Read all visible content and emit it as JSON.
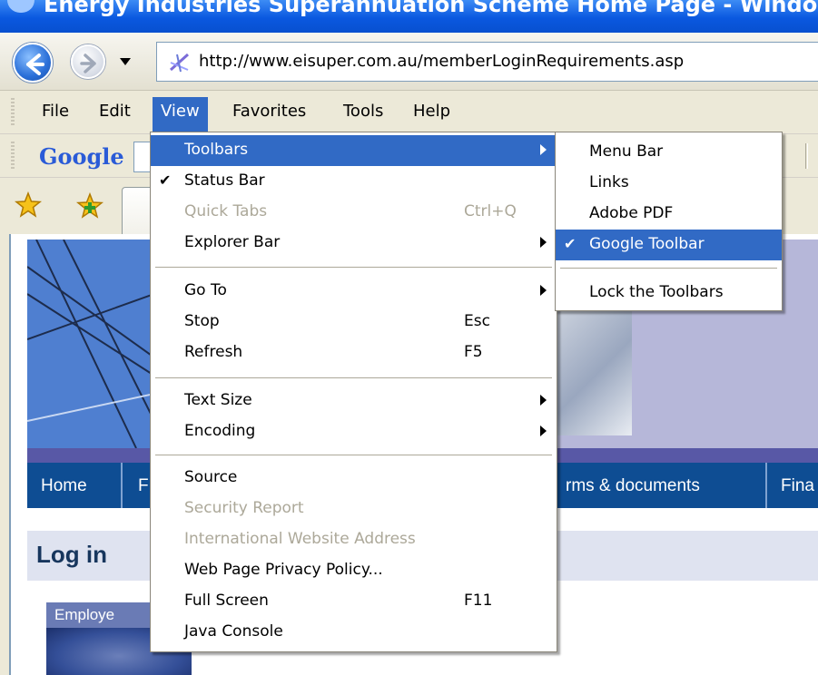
{
  "window": {
    "title": "Energy Industries Superannuation Scheme Home Page - Windows Inte"
  },
  "address_bar": {
    "url": "http://www.eisuper.com.au/memberLoginRequirements.asp"
  },
  "menu_bar": {
    "items": [
      {
        "label": "File"
      },
      {
        "label": "Edit"
      },
      {
        "label": "View"
      },
      {
        "label": "Favorites"
      },
      {
        "label": "Tools"
      },
      {
        "label": "Help"
      }
    ],
    "active": "View"
  },
  "google_toolbar": {
    "logo": "Google"
  },
  "view_menu": {
    "items": [
      {
        "label": "Toolbars",
        "submenu": true,
        "highlighted": true
      },
      {
        "label": "Status Bar",
        "checked": true
      },
      {
        "label": "Quick Tabs",
        "shortcut": "Ctrl+Q",
        "disabled": true
      },
      {
        "label": "Explorer Bar",
        "submenu": true
      },
      {
        "label": "Go To",
        "submenu": true
      },
      {
        "label": "Stop",
        "shortcut": "Esc"
      },
      {
        "label": "Refresh",
        "shortcut": "F5"
      },
      {
        "label": "Text Size",
        "submenu": true
      },
      {
        "label": "Encoding",
        "submenu": true
      },
      {
        "label": "Source"
      },
      {
        "label": "Security Report",
        "disabled": true
      },
      {
        "label": "International Website Address",
        "disabled": true
      },
      {
        "label": "Web Page Privacy Policy..."
      },
      {
        "label": "Full Screen",
        "shortcut": "F11"
      },
      {
        "label": "Java Console"
      }
    ]
  },
  "toolbars_submenu": {
    "items": [
      {
        "label": "Menu Bar"
      },
      {
        "label": "Links"
      },
      {
        "label": "Adobe PDF"
      },
      {
        "label": "Google Toolbar",
        "checked": true,
        "highlighted": true
      },
      {
        "label": "Lock the Toolbars"
      }
    ]
  },
  "page": {
    "nav": [
      {
        "label": "Home"
      },
      {
        "label": "F"
      },
      {
        "label": "rms & documents"
      },
      {
        "label": "Fina"
      }
    ],
    "login_title": "Log in",
    "employer_label": "Employe"
  },
  "colors": {
    "highlight": "#316ac5",
    "nav_bg": "#0e4d93",
    "banner": "#b6b7d9"
  }
}
